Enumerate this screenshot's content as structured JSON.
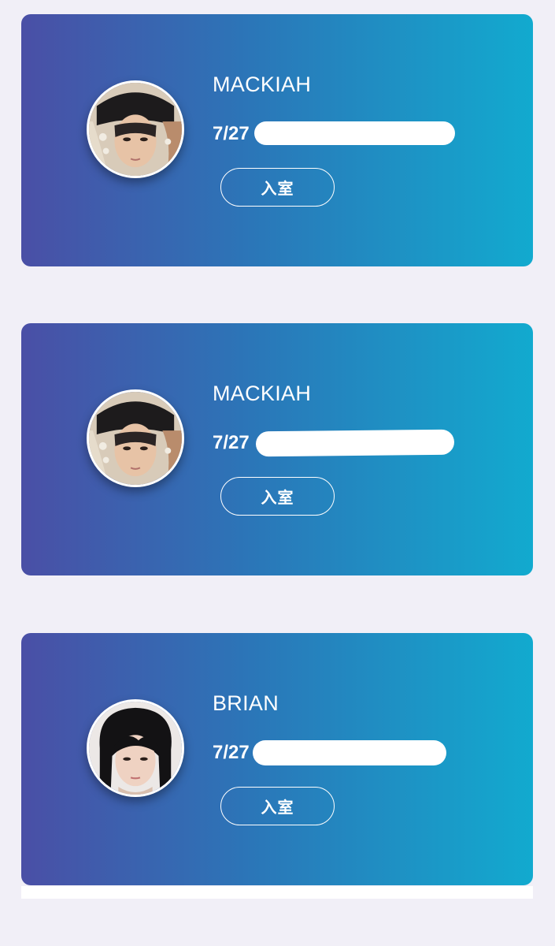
{
  "colors": {
    "page_background": "#f1eff7",
    "card_gradient_start": "#4a4fa6",
    "card_gradient_end": "#12aacf",
    "text": "#ffffff"
  },
  "cards": [
    {
      "name": "MACKIAH",
      "date": "7/27",
      "button_label": "入室",
      "avatar": "member-photo-beanie"
    },
    {
      "name": "MACKIAH",
      "date": "7/27",
      "button_label": "入室",
      "avatar": "member-photo-beanie"
    },
    {
      "name": "BRIAN",
      "date": "7/27",
      "button_label": "入室",
      "avatar": "member-photo-dark-hair"
    }
  ]
}
